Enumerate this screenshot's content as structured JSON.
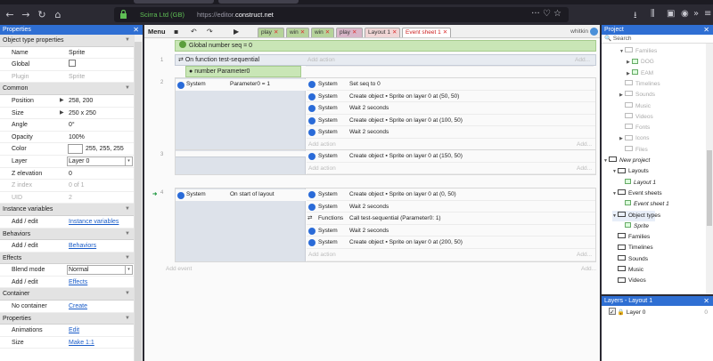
{
  "browser": {
    "org": "Scirra Ltd (GB)",
    "url_host": "https://editor.",
    "url_domain": "construct.net",
    "url_icons": "··· ♡ ☆"
  },
  "props": {
    "title": "Properties",
    "rows": [
      {
        "kind": "section",
        "label": "Object type properties"
      },
      {
        "kind": "value",
        "label": "Name",
        "value": "Sprite"
      },
      {
        "kind": "checkbox",
        "label": "Global",
        "value": ""
      },
      {
        "kind": "dim",
        "label": "Plugin",
        "value": "Sprite"
      },
      {
        "kind": "section",
        "label": "Common"
      },
      {
        "kind": "expand",
        "label": "Position",
        "value": "258, 200"
      },
      {
        "kind": "expand",
        "label": "Size",
        "value": "250 x 250"
      },
      {
        "kind": "value",
        "label": "Angle",
        "value": "0°"
      },
      {
        "kind": "value",
        "label": "Opacity",
        "value": "100%"
      },
      {
        "kind": "color",
        "label": "Color",
        "value": "255, 255, 255"
      },
      {
        "kind": "select",
        "label": "Layer",
        "value": "Layer 0"
      },
      {
        "kind": "value",
        "label": "Z elevation",
        "value": "0"
      },
      {
        "kind": "dim",
        "label": "Z index",
        "value": "0 of 1"
      },
      {
        "kind": "dim",
        "label": "UID",
        "value": "2"
      },
      {
        "kind": "section",
        "label": "Instance variables"
      },
      {
        "kind": "link",
        "label": "Add / edit",
        "value": "Instance variables"
      },
      {
        "kind": "section",
        "label": "Behaviors"
      },
      {
        "kind": "link",
        "label": "Add / edit",
        "value": "Behaviors"
      },
      {
        "kind": "section",
        "label": "Effects"
      },
      {
        "kind": "select",
        "label": "Blend mode",
        "value": "Normal"
      },
      {
        "kind": "link",
        "label": "Add / edit",
        "value": "Effects"
      },
      {
        "kind": "section",
        "label": "Container"
      },
      {
        "kind": "link",
        "label": "No container",
        "value": "Create"
      },
      {
        "kind": "section",
        "label": "Properties"
      },
      {
        "kind": "link",
        "label": "Animations",
        "value": "Edit"
      },
      {
        "kind": "link",
        "label": "Size",
        "value": "Make 1:1"
      }
    ]
  },
  "toolbar": {
    "menu": "Menu",
    "user": "whitkin",
    "tabs": [
      {
        "label": "play",
        "color": "#b5d39a"
      },
      {
        "label": "win",
        "color": "#b5d39a"
      },
      {
        "label": "win",
        "color": "#b5d39a"
      },
      {
        "label": "play",
        "color": "#d8b5c8"
      },
      {
        "label": "Layout 1",
        "color": "#f1d6d6"
      },
      {
        "label": "Event sheet 1",
        "color": "#ffffff",
        "active": true
      }
    ]
  },
  "sheet": {
    "global_var": "Global number seq = 0",
    "fn_header": "On function test-sequential",
    "fn_param": "number Parameter0",
    "add_action": "Add action",
    "add_right": "Add...",
    "add_event": "Add event",
    "events": [
      {
        "num": "1",
        "cond_obj": "",
        "cond_text": "",
        "actions": []
      },
      {
        "num": "2",
        "cond_obj": "System",
        "cond_text": "Parameter0 = 1",
        "actions": [
          {
            "obj": "System",
            "desc": "Set seq to 0"
          },
          {
            "obj": "System",
            "desc": "Create object ▪ Sprite on layer 0 at (50, 50)"
          },
          {
            "obj": "System",
            "desc": "Wait 2 seconds"
          },
          {
            "obj": "System",
            "desc": "Create object ▪ Sprite on layer 0 at (100, 50)"
          },
          {
            "obj": "System",
            "desc": "Wait 2 seconds"
          }
        ]
      },
      {
        "num": "3",
        "cond_obj": "",
        "cond_text": "",
        "actions": [
          {
            "obj": "System",
            "desc": "Create object ▪ Sprite on layer 0 at (150, 50)"
          }
        ]
      },
      {
        "num": "4",
        "cond_obj": "System",
        "cond_text": "On start of layout",
        "actions": [
          {
            "obj": "System",
            "desc": "Create object ▪ Sprite on layer 0 at (0, 50)"
          },
          {
            "obj": "System",
            "desc": "Wait 2 seconds"
          },
          {
            "obj": "Functions",
            "desc": "Call test-sequential (Parameter0: 1)"
          },
          {
            "obj": "System",
            "desc": "Wait 2 seconds"
          },
          {
            "obj": "System",
            "desc": "Create object ▪ Sprite on layer 0 at (200, 50)"
          }
        ]
      }
    ]
  },
  "project": {
    "title": "Project",
    "search": "Search",
    "tree": [
      {
        "label": "Families",
        "dim": true
      },
      {
        "label": "DOG",
        "dim": true
      },
      {
        "label": "EAM",
        "dim": true
      },
      {
        "label": "Timelines",
        "dim": true
      },
      {
        "label": "Sounds",
        "dim": true
      },
      {
        "label": "Music",
        "dim": true
      },
      {
        "label": "Videos",
        "dim": true
      },
      {
        "label": "Fonts",
        "dim": true
      },
      {
        "label": "Icons",
        "dim": true
      },
      {
        "label": "Files",
        "dim": true
      },
      {
        "label": "New project",
        "dim": false
      },
      {
        "label": "Layouts",
        "dim": false
      },
      {
        "label": "Layout 1",
        "dim": false
      },
      {
        "label": "Event sheets",
        "dim": false
      },
      {
        "label": "Event sheet 1",
        "dim": false
      },
      {
        "label": "Object types",
        "dim": false
      },
      {
        "label": "Sprite",
        "dim": false
      },
      {
        "label": "Families",
        "dim": false
      },
      {
        "label": "Timelines",
        "dim": false
      },
      {
        "label": "Sounds",
        "dim": false
      },
      {
        "label": "Music",
        "dim": false
      },
      {
        "label": "Videos",
        "dim": false
      }
    ]
  },
  "layers": {
    "title": "Layers - Layout 1",
    "rows": [
      {
        "label": "Layer 0",
        "num": "0"
      }
    ]
  }
}
